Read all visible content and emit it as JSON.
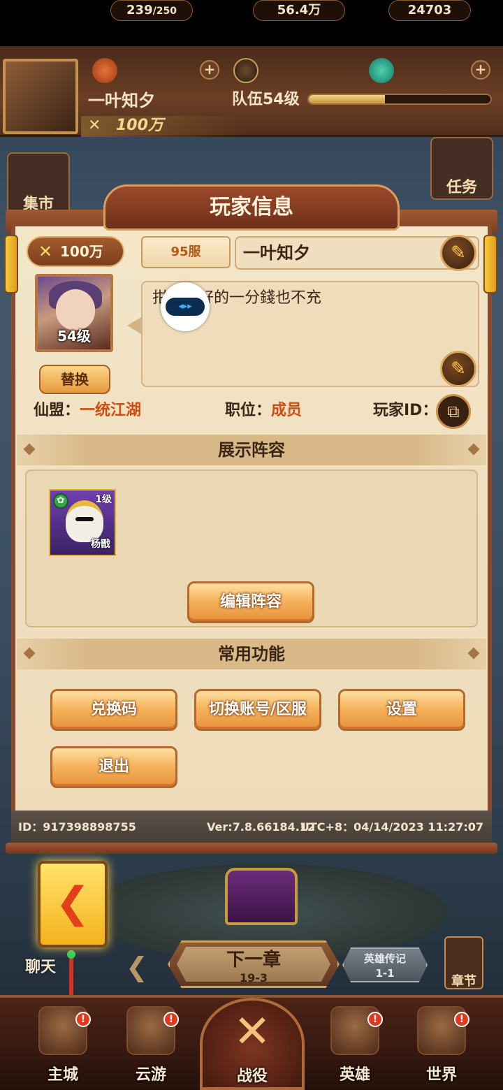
{
  "hud": {
    "stamina": "239",
    "stamina_max": "/250",
    "coins": "56.4万",
    "gems": "24703",
    "player_name": "一叶知夕",
    "team_level": "队伍54级",
    "team_exp_fraction": 0.42,
    "power": "100万"
  },
  "side_buttons": {
    "market": "集市",
    "tasks": "任务"
  },
  "panel": {
    "title": "玩家信息",
    "power": "100万",
    "server": "95服",
    "player_name": "一叶知夕",
    "avatar_level": "54级",
    "swap_label": "替换",
    "signature": "拑　　好的一分錢也不充",
    "float_label": "◂▸▸",
    "alliance_label": "仙盟：",
    "alliance_value": "一统江湖",
    "position_label": "职位：",
    "position_value": "成员",
    "player_id_label": "玩家ID：",
    "lineup_section": "展示阵容",
    "hero": {
      "level": "1级",
      "name": "杨戬"
    },
    "edit_lineup": "编辑阵容",
    "functions_section": "常用功能",
    "buttons": {
      "redeem": "兑换码",
      "switch_account": "切换账号/区服",
      "settings": "设置",
      "logout": "退出"
    },
    "footer": {
      "id": "ID：917398898755",
      "version": "Ver:7.8.66184.12",
      "time": "UTC+8：04/14/2023 11:27:07"
    }
  },
  "stage": {
    "next_chapter": "下一章",
    "chapter_num": "19-3",
    "legend_title": "英雄传记",
    "legend_num": "1-1",
    "chapter_label": "章节",
    "chat_label": "聊天"
  },
  "nav": {
    "main_city": "主城",
    "travel": "云游",
    "battle": "战役",
    "heroes": "英雄",
    "world": "世界",
    "badge": "!"
  }
}
